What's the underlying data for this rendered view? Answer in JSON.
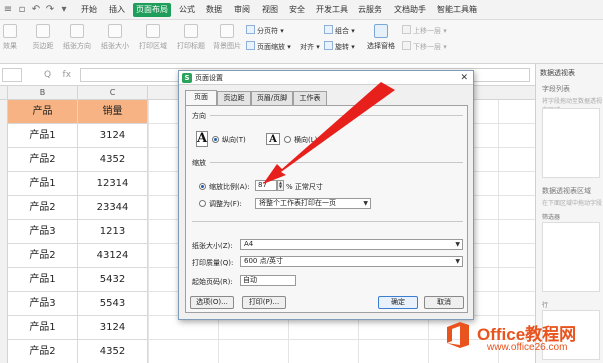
{
  "menubar": {
    "items": [
      "开始",
      "插入",
      "页面布局",
      "公式",
      "数据",
      "审阅",
      "视图",
      "安全",
      "开发工具",
      "云服务",
      "文档助手",
      "智能工具箱"
    ],
    "active_index": 2
  },
  "ribbon": {
    "buttons": [
      "效果",
      "页边距",
      "纸张方向",
      "纸张大小",
      "打印区域",
      "打印标题",
      "背景图片"
    ],
    "enabled": [
      false,
      false,
      false,
      false,
      false,
      false,
      false
    ],
    "small": {
      "fen_ye_fu": "分页符",
      "page_zoom": "页面缩放",
      "combine": "组合",
      "rotate": "旋转",
      "align": "对齐",
      "select_pane": "选择窗格",
      "up_one": "上移一层",
      "down_one": "下移一层"
    }
  },
  "formulabar": {
    "fx": "fx",
    "zoom_icon": "Q"
  },
  "sheet": {
    "columns": [
      "B",
      "C"
    ],
    "header": [
      "产品",
      "销量"
    ],
    "rows": [
      [
        "产品1",
        "3124"
      ],
      [
        "产品2",
        "4352"
      ],
      [
        "产品1",
        "12314"
      ],
      [
        "产品2",
        "23344"
      ],
      [
        "产品3",
        "1213"
      ],
      [
        "产品2",
        "43124"
      ],
      [
        "产品1",
        "5432"
      ],
      [
        "产品3",
        "5543"
      ],
      [
        "产品1",
        "3124"
      ],
      [
        "产品2",
        "4352"
      ]
    ],
    "header_color": "#f7b383"
  },
  "right_pane": {
    "title": "数据透视表",
    "field_list": "字段列表",
    "field_hint": "将字段拖动至数据透视表区域",
    "area_title": "数据透视表区域",
    "area_hint": "在下面区域中拖动字段",
    "filter": "筛选器",
    "row": "行"
  },
  "dialog": {
    "title": "页面设置",
    "tabs": [
      "页面",
      "页边距",
      "页眉/页脚",
      "工作表"
    ],
    "active_tab": 0,
    "direction_label": "方向",
    "portrait_label": "纵向(T)",
    "landscape_label": "横向(L)",
    "orientation": "portrait",
    "scale_label": "缩放",
    "scale_ratio_label": "缩放比例(A):",
    "scale_value": "87",
    "scale_suffix": "% 正常尺寸",
    "fit_label": "调整为(F):",
    "fit_value": "将整个工作表打印在一页",
    "scale_mode": "ratio",
    "paper_size_label": "纸张大小(Z):",
    "paper_size_value": "A4",
    "print_quality_label": "打印质量(Q):",
    "print_quality_value": "600 点/英寸",
    "first_page_label": "起始页码(R):",
    "first_page_value": "自动",
    "options_button": "选项(O)...",
    "print_button": "打印(P)...",
    "ok_button": "确定",
    "cancel_button": "取消"
  },
  "watermark": {
    "name": "Office教程网",
    "url": "www.office26.com",
    "color": "#e8531e"
  },
  "annotation": {
    "arrow_color": "#e8201c"
  }
}
